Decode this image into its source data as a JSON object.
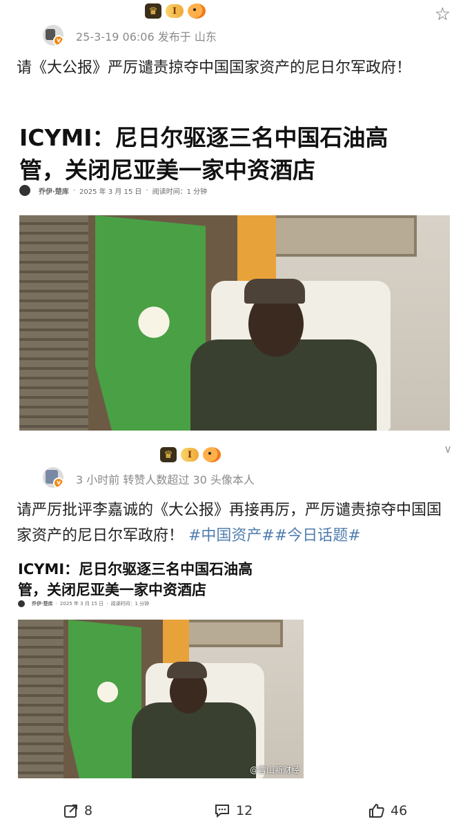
{
  "post1": {
    "level_badge": "I",
    "meta": "25-3-19 06:06  发布于 山东",
    "text": "请《大公报》严厉谴责掠夺中国国家资产的尼日尔军政府！",
    "article": {
      "title_line1": "ICYMI：尼日尔驱逐三名中国石油高",
      "title_line2": "管，关闭尼亚美一家中资酒店",
      "author": "乔伊·楚库",
      "date": "2025 年 3 月 15 日",
      "read_time": "阅读时间：1 分钟"
    }
  },
  "post2": {
    "level_badge": "I",
    "meta": "3 小时前  转赞人数超过 30  头像本人",
    "text_main": "请严厉批评李嘉诚的《大公报》再接再厉，严厉谴责掠夺中国国家资产的尼日尔军政府！ ",
    "tags": "#中国资产##今日话题#",
    "article": {
      "title_line1": "ICYMI：尼日尔驱逐三名中国石油高",
      "title_line2": "管，关闭尼亚美一家中资酒店",
      "author": "乔伊·楚库",
      "date": "2025 年 3 月 15 日",
      "read_time": "阅读时间：1 分钟"
    },
    "watermark": "@雪山新财经"
  },
  "footer": {
    "repost_count": "8",
    "comment_count": "12",
    "like_count": "46"
  },
  "icons": {
    "star": "star-icon",
    "chevron": "chevron-down-icon",
    "repost": "repost-icon",
    "comment": "comment-icon",
    "like": "like-icon"
  },
  "colors": {
    "link": "#507daf",
    "verified": "#f08a17"
  }
}
